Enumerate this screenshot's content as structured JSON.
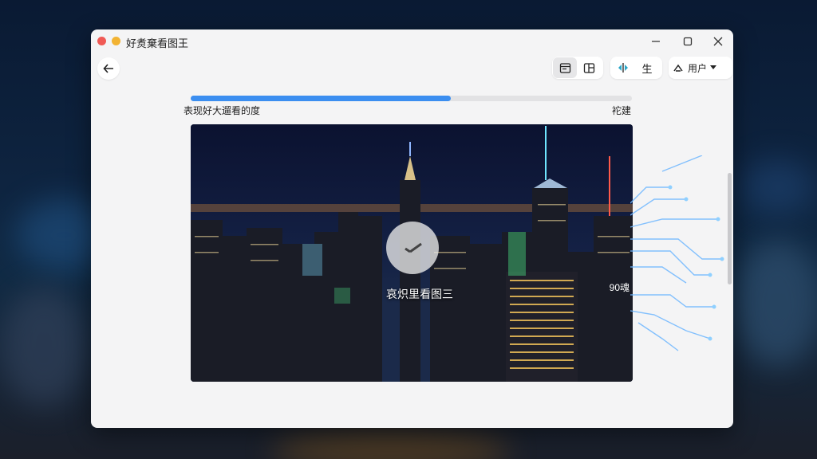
{
  "window": {
    "title": "好煑棄看图王"
  },
  "toolbar": {
    "back_icon": "arrow-left-icon",
    "view_a_icon": "window-icon",
    "view_b_icon": "layout-icon",
    "sync_icon": "split-icon",
    "mid_label": "生",
    "user_label": "用户",
    "user_icon": "cloud-icon"
  },
  "progress": {
    "value": 0.59,
    "label": "表现好大遛看的度",
    "right_label": "袉建"
  },
  "image": {
    "caption": "哀炽里看图三",
    "corner_tag": "90魂"
  },
  "colors": {
    "accent": "#3b8ef0",
    "close_dot": "#f05a55",
    "min_dot": "#f2b333"
  }
}
